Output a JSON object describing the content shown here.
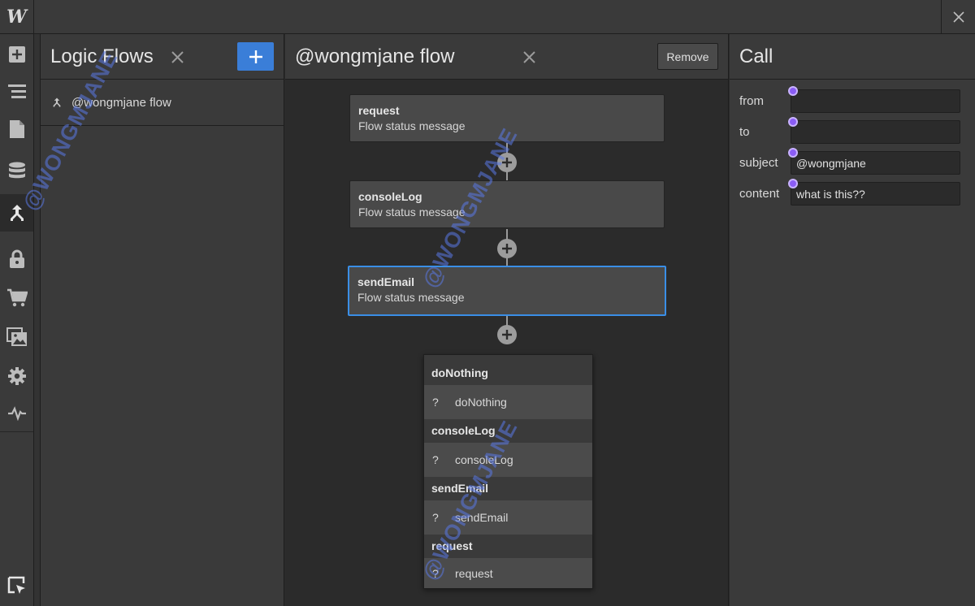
{
  "app": {
    "logo": "W"
  },
  "flows_panel": {
    "title": "Logic Flows",
    "add_label": "+",
    "items": [
      {
        "label": "@wongmjane flow"
      }
    ]
  },
  "canvas": {
    "title": "@wongmjane flow",
    "remove_label": "Remove",
    "nodes": [
      {
        "title": "request",
        "subtitle": "Flow status message"
      },
      {
        "title": "consoleLog",
        "subtitle": "Flow status message"
      },
      {
        "title": "sendEmail",
        "subtitle": "Flow status message"
      }
    ],
    "menu": [
      {
        "group": "doNothing",
        "mark": "?",
        "label": "doNothing"
      },
      {
        "group": "consoleLog",
        "mark": "?",
        "label": "consoleLog"
      },
      {
        "group": "sendEmail",
        "mark": "?",
        "label": "sendEmail"
      },
      {
        "group": "request",
        "mark": "?",
        "label": "request"
      }
    ]
  },
  "call_panel": {
    "title": "Call",
    "fields": [
      {
        "label": "from",
        "value": ""
      },
      {
        "label": "to",
        "value": ""
      },
      {
        "label": "subject",
        "value": "@wongmjane"
      },
      {
        "label": "content",
        "value": "what is this??"
      }
    ]
  },
  "watermark": "@WONGMJANE",
  "colors": {
    "accent": "#3a7ed8",
    "selected_border": "#3a8ee6",
    "binding_dot": "#8a5cf5",
    "watermark": "#5a78e6"
  }
}
